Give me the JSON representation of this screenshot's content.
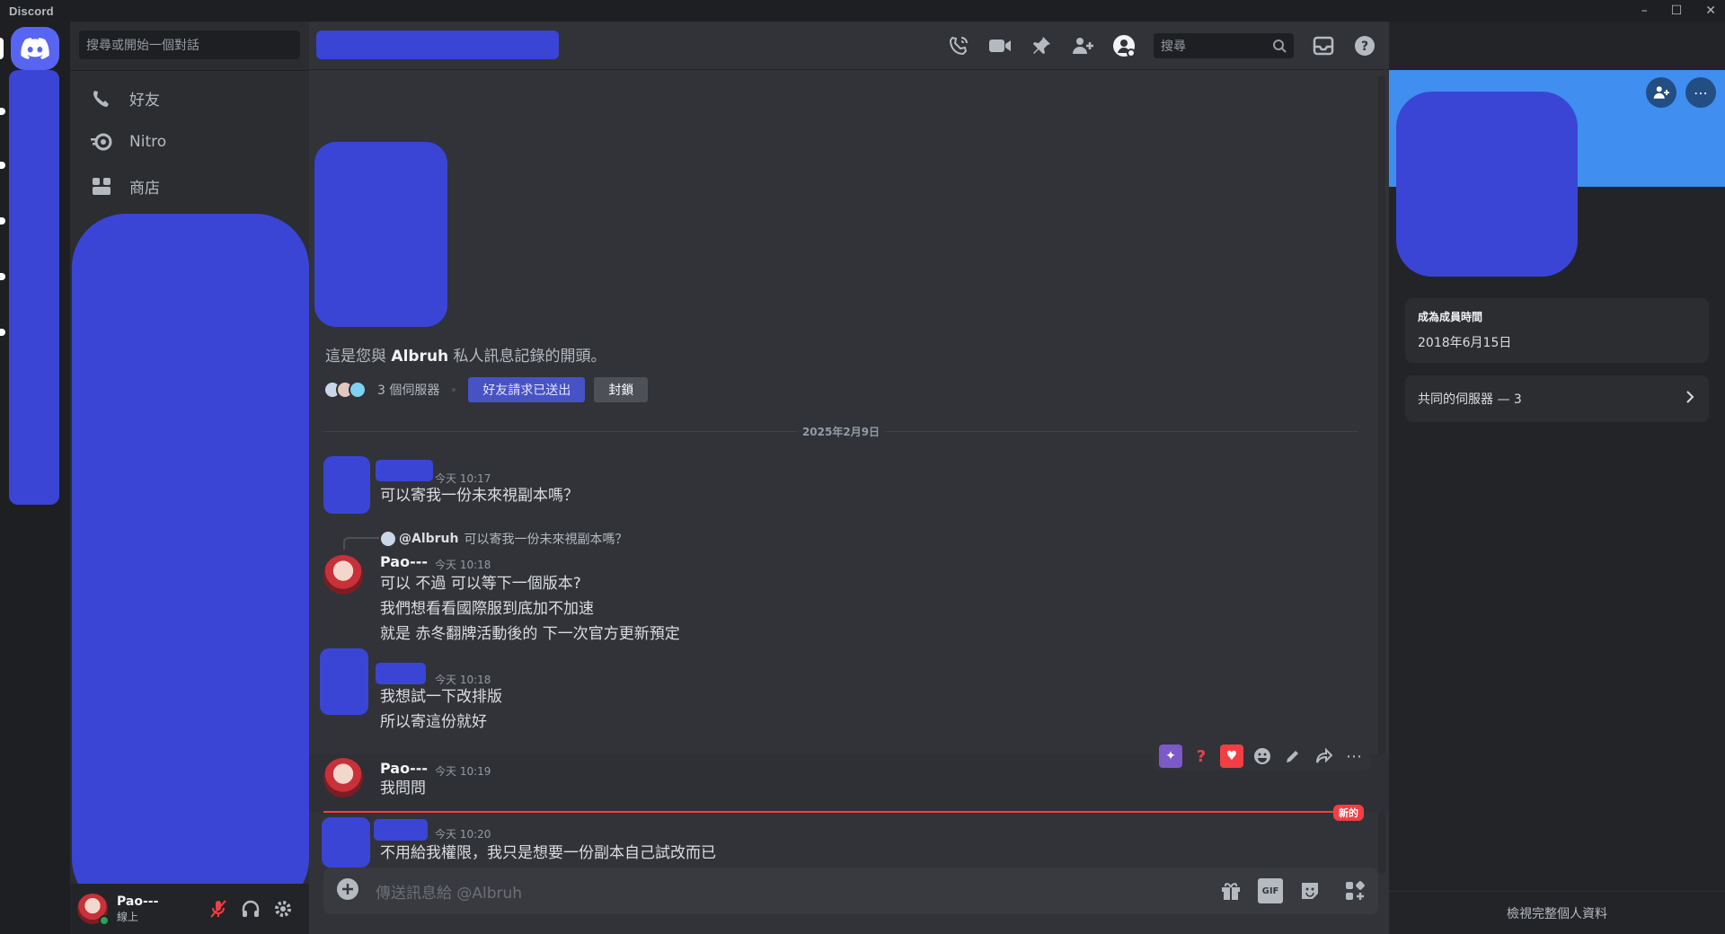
{
  "window": {
    "title": "Discord"
  },
  "dm_sidebar": {
    "search_placeholder": "搜尋或開始一個對話",
    "nav": [
      {
        "label": "好友"
      },
      {
        "label": "Nitro"
      },
      {
        "label": "商店"
      }
    ]
  },
  "user_panel": {
    "name": "Pao---",
    "status": "線上"
  },
  "header": {
    "search_placeholder": "搜尋",
    "icons": [
      "phone-call-icon",
      "video-call-icon",
      "pin-icon",
      "add-friend-icon",
      "user-profile-icon",
      "inbox-icon",
      "help-icon"
    ]
  },
  "intro": {
    "text_pre": "這是您與 ",
    "username": "Albruh",
    "text_post": " 私人訊息記錄的開頭。",
    "mutual_servers": "3 個伺服器",
    "friend_request_button": "好友請求已送出",
    "block_button": "封鎖"
  },
  "date_divider": "2025年2月9日",
  "messages": [
    {
      "time": "今天 10:17",
      "lines": [
        "可以寄我一份未來視副本嗎？"
      ]
    },
    {
      "reply_mention": "@Albruh",
      "reply_text": "可以寄我一份未來視副本嗎？",
      "author": "Pao---",
      "time": "今天 10:18",
      "lines": [
        "可以 不過 可以等下一個版本?",
        "我們想看看國際服到底加不加速",
        "就是 赤冬翻牌活動後的 下一次官方更新預定"
      ]
    },
    {
      "time": "今天 10:18",
      "lines": [
        "我想試一下改排版",
        "所以寄這份就好"
      ]
    },
    {
      "author": "Pao---",
      "time": "今天 10:19",
      "lines": [
        "我問問"
      ]
    },
    {
      "time": "今天 10:20",
      "lines": [
        "不用給我權限，我只是想要一份副本自己試改而已"
      ]
    }
  ],
  "new_badge": "新的",
  "composer": {
    "placeholder": "傳送訊息給 @Albruh",
    "gif_label": "GIF"
  },
  "profile": {
    "member_since_label": "成為成員時間",
    "member_since_value": "2018年6月15日",
    "mutual_servers": "共同的伺服器 — 3",
    "view_full": "檢視完整個人資料"
  },
  "colors": {
    "accent": "#5865f2",
    "redaction": "#3a45d6",
    "banner": "#3f8ef0",
    "new_line": "#f23f43",
    "online": "#23a55a"
  }
}
